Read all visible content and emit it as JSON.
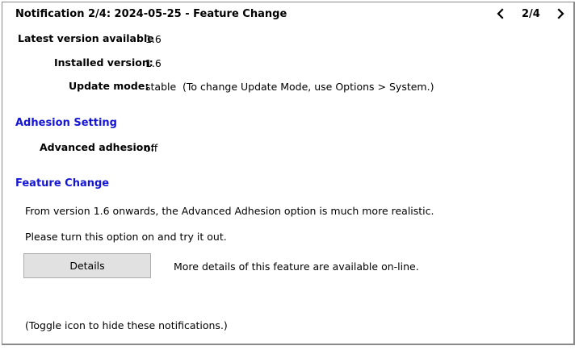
{
  "header": {
    "title": "Notification 2/4: 2024-05-25 - Feature Change",
    "counter": "2/4",
    "prev_icon": "chevron-left-icon",
    "next_icon": "chevron-right-icon"
  },
  "version_info": {
    "latest_label": "Latest version available",
    "latest_value": "1.6",
    "installed_label": "Installed version:",
    "installed_value": "1.6",
    "mode_label": "Update mode:",
    "mode_value": "stable",
    "mode_note": "(To change Update Mode, use Options > System.)"
  },
  "adhesion": {
    "heading": "Adhesion Setting",
    "label": "Advanced adhesion:",
    "value": "off"
  },
  "feature": {
    "heading": "Feature Change",
    "line1": "From version 1.6 onwards, the Advanced Adhesion option is much more realistic.",
    "line2": "Please turn this option on and try it out.",
    "details_button": "Details",
    "details_note": "More details of this feature are available on-line."
  },
  "footer": {
    "toggle_note": "(Toggle icon to hide these notifications.)"
  },
  "colors": {
    "section_heading": "#1515d6",
    "border": "#8a8a8a",
    "button_bg": "#e1e1e1"
  }
}
